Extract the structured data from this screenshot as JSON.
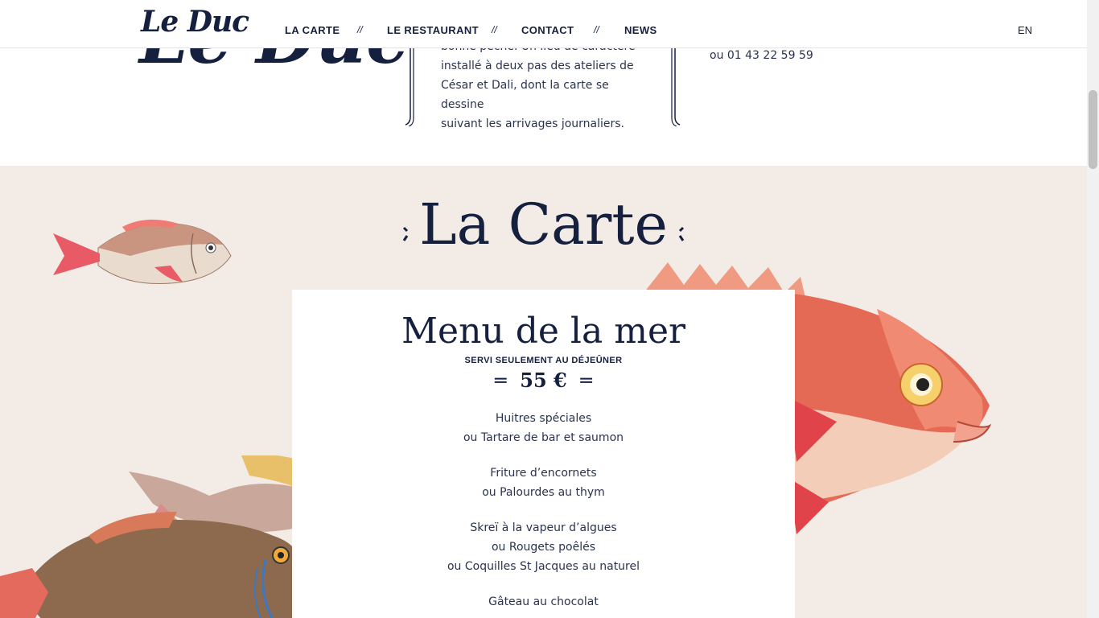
{
  "header": {
    "logo": "Le Duc",
    "nav": [
      "LA CARTE",
      "LE RESTAURANT",
      "CONTACT",
      "NEWS"
    ],
    "separator": "//",
    "lang": "EN"
  },
  "intro": {
    "big_logo": "Le Duc",
    "text_lines": [
      "bonne pêche. Un lieu de caractère",
      "installé à deux pas des ateliers de",
      "César et Dali, dont la carte se dessine",
      "suivant les arrivages journaliers."
    ],
    "phone": "ou 01 43 22 59 59"
  },
  "carte": {
    "title": "La Carte",
    "menu": {
      "title": "Menu de la mer",
      "subtitle": "SERVI SEULEMENT AU DÉJEÛNER",
      "price": "55 €",
      "groups": [
        [
          "Huitres spéciales",
          "ou Tartare de bar et saumon"
        ],
        [
          "Friture d’encornets",
          "ou Palourdes au thym"
        ],
        [
          "Skreï à la vapeur d’algues",
          "ou Rougets poêlés",
          "ou Coquilles St Jacques au naturel"
        ],
        [
          "Gâteau au chocolat"
        ]
      ]
    }
  },
  "colors": {
    "navy": "#15203f",
    "section_bg": "#f3ebe5",
    "fish_red": "#e0574a"
  }
}
